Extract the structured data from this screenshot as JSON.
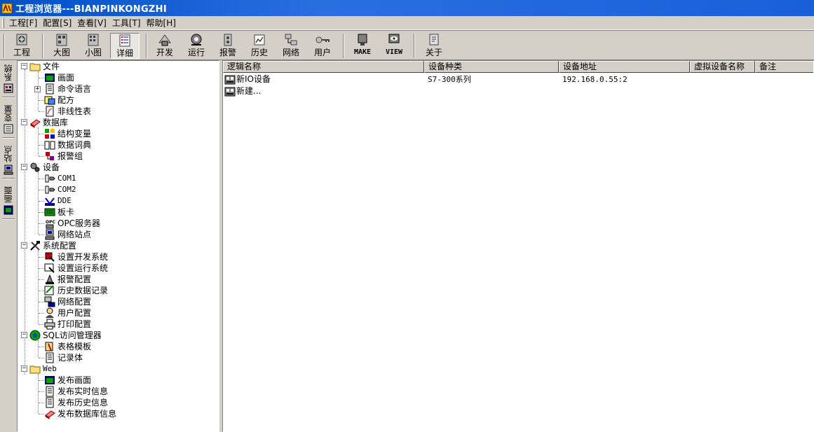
{
  "window": {
    "title": "工程浏览器---BIANPINKONGZHI"
  },
  "menu": [
    "工程[F]",
    "配置[S]",
    "查看[V]",
    "工具[T]",
    "帮助[H]"
  ],
  "toolbar": {
    "project": "工程",
    "large": "大图",
    "small": "小图",
    "detail": "详细",
    "develop": "开发",
    "run": "运行",
    "alarm": "报警",
    "history": "历史",
    "network": "网络",
    "user": "用户",
    "make": "MAKE",
    "view": "VIEW",
    "about": "关于"
  },
  "sidetabs": [
    "系统",
    "变量",
    "站点",
    "画面"
  ],
  "tree": {
    "file": "文件",
    "screen": "画面",
    "command_lang": "命令语言",
    "recipe": "配方",
    "nonlinear": "非线性表",
    "database": "数据库",
    "struct_var": "结构变量",
    "data_dict": "数据词典",
    "alarm_group": "报警组",
    "device": "设备",
    "com1": "COM1",
    "com2": "COM2",
    "dde": "DDE",
    "board": "板卡",
    "opc": "OPC服务器",
    "net_station": "网络站点",
    "sys_config": "系统配置",
    "set_dev": "设置开发系统",
    "set_run": "设置运行系统",
    "alarm_cfg": "报警配置",
    "hist_rec": "历史数据记录",
    "net_cfg": "网络配置",
    "user_cfg": "用户配置",
    "print_cfg": "打印配置",
    "sql": "SQL访问管理器",
    "table_tpl": "表格模板",
    "recordset": "记录体",
    "web": "Web",
    "pub_screen": "发布画面",
    "pub_realtime": "发布实时信息",
    "pub_history": "发布历史信息",
    "pub_db": "发布数据库信息"
  },
  "list": {
    "columns": [
      "逻辑名称",
      "设备种类",
      "设备地址",
      "虚拟设备名称",
      "备注"
    ],
    "rows": [
      {
        "name": "新IO设备",
        "type": "S7-300系列",
        "address": "192.168.0.55:2",
        "virtual": "",
        "note": ""
      },
      {
        "name": "新建...",
        "type": "",
        "address": "",
        "virtual": "",
        "note": ""
      }
    ]
  },
  "colors": {
    "titlebar": "#0050c8",
    "face": "#d4d0c8",
    "window": "#ffffff"
  }
}
